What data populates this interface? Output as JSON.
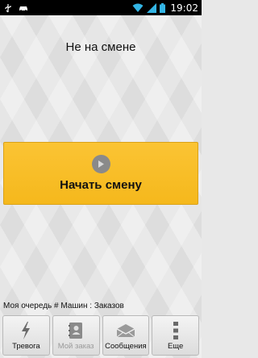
{
  "status_bar": {
    "time": "19:02",
    "icons": [
      "usb-icon",
      "car-icon",
      "wifi-icon",
      "signal-icon",
      "battery-icon"
    ]
  },
  "main": {
    "shift_status": "Не на смене",
    "start_shift_label": "Начать смену",
    "queue_info": "Моя очередь # Машин : Заказов"
  },
  "bottom_tabs": [
    {
      "label": "Тревога",
      "icon": "lightning-icon",
      "enabled": true
    },
    {
      "label": "Мой заказ",
      "icon": "contact-book-icon",
      "enabled": false
    },
    {
      "label": "Сообщения",
      "icon": "envelope-icon",
      "enabled": true
    },
    {
      "label": "Еще",
      "icon": "more-dots-icon",
      "enabled": true
    }
  ],
  "colors": {
    "accent": "#f5b81c",
    "background": "#e6e6e6"
  }
}
